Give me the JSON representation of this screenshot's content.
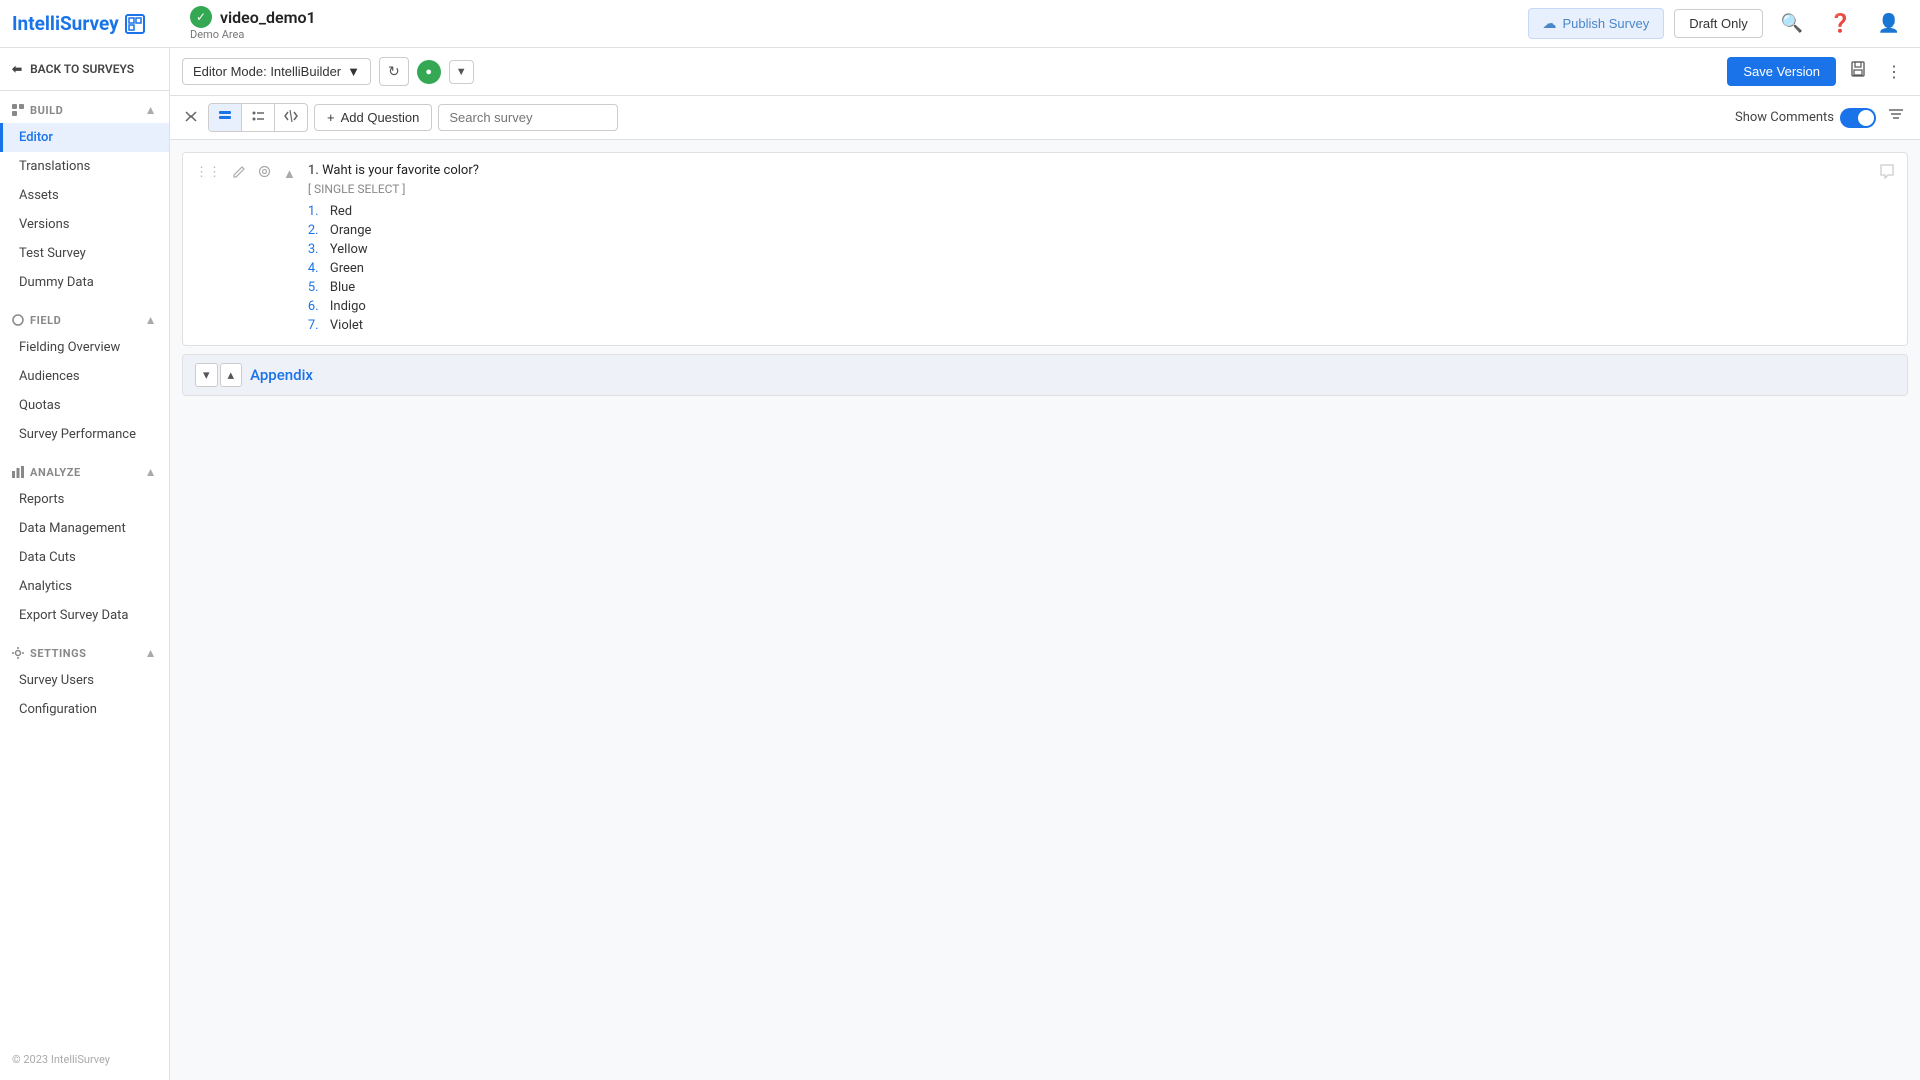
{
  "app": {
    "name": "IntelliSurvey",
    "logo_label": "IS"
  },
  "header": {
    "survey_name": "video_demo1",
    "survey_area": "Demo Area",
    "status_icon": "✓",
    "publish_label": "Publish Survey",
    "draft_label": "Draft Only"
  },
  "sidebar": {
    "back_label": "BACK TO SURVEYS",
    "sections": [
      {
        "key": "build",
        "label": "BUILD",
        "items": [
          {
            "key": "editor",
            "label": "Editor",
            "active": true
          },
          {
            "key": "translations",
            "label": "Translations"
          },
          {
            "key": "assets",
            "label": "Assets"
          },
          {
            "key": "versions",
            "label": "Versions"
          },
          {
            "key": "test-survey",
            "label": "Test Survey"
          },
          {
            "key": "dummy-data",
            "label": "Dummy Data"
          }
        ]
      },
      {
        "key": "field",
        "label": "FIELD",
        "items": [
          {
            "key": "fielding-overview",
            "label": "Fielding Overview"
          },
          {
            "key": "audiences",
            "label": "Audiences"
          },
          {
            "key": "quotas",
            "label": "Quotas"
          },
          {
            "key": "survey-performance",
            "label": "Survey Performance"
          }
        ]
      },
      {
        "key": "analyze",
        "label": "ANALYZE",
        "items": [
          {
            "key": "reports",
            "label": "Reports"
          },
          {
            "key": "data-management",
            "label": "Data Management"
          },
          {
            "key": "data-cuts",
            "label": "Data Cuts"
          },
          {
            "key": "analytics",
            "label": "Analytics"
          },
          {
            "key": "export-survey-data",
            "label": "Export Survey Data"
          }
        ]
      },
      {
        "key": "settings",
        "label": "SETTINGS",
        "items": [
          {
            "key": "survey-users",
            "label": "Survey Users"
          },
          {
            "key": "configuration",
            "label": "Configuration"
          }
        ]
      }
    ],
    "footer": "© 2023 IntelliSurvey"
  },
  "editor_toolbar": {
    "mode_label": "Editor Mode: IntelliBuilder",
    "save_version_label": "Save Version"
  },
  "question_toolbar": {
    "add_question_label": "Add Question",
    "search_placeholder": "Search survey",
    "show_comments_label": "Show Comments"
  },
  "questions": [
    {
      "number": "1.",
      "text": "Waht is your favorite color?",
      "type": "[ SINGLE SELECT ]",
      "answers": [
        {
          "num": "1.",
          "text": "Red"
        },
        {
          "num": "2.",
          "text": "Orange"
        },
        {
          "num": "3.",
          "text": "Yellow"
        },
        {
          "num": "4.",
          "text": "Green"
        },
        {
          "num": "5.",
          "text": "Blue"
        },
        {
          "num": "6.",
          "text": "Indigo"
        },
        {
          "num": "7.",
          "text": "Violet"
        }
      ]
    }
  ],
  "appendix": {
    "title": "Appendix"
  }
}
